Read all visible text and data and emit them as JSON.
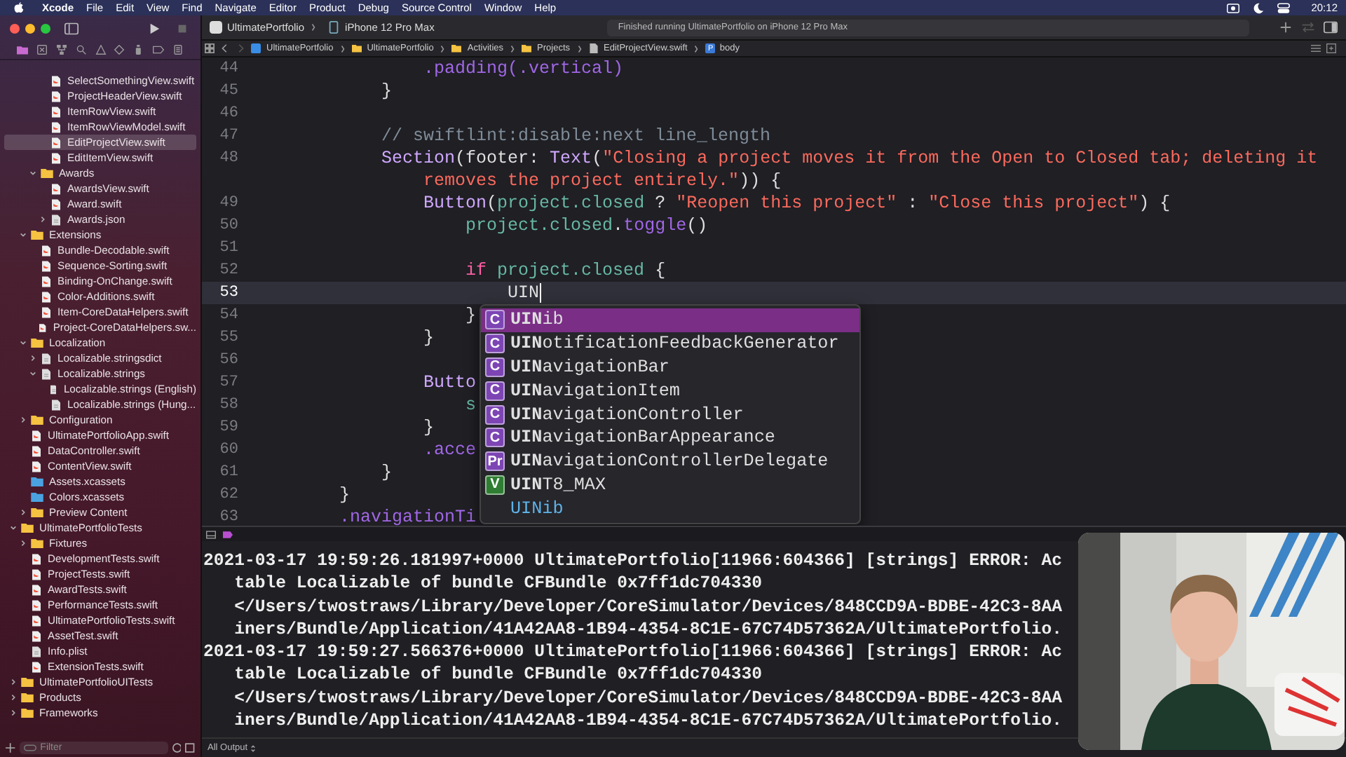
{
  "menu_bar": {
    "items": [
      {
        "label": "Xcode",
        "kind": "app"
      },
      {
        "label": "File",
        "kind": "menu"
      },
      {
        "label": "Edit",
        "kind": "menu"
      },
      {
        "label": "View",
        "kind": "menu"
      },
      {
        "label": "Find",
        "kind": "menu"
      },
      {
        "label": "Navigate",
        "kind": "menu"
      },
      {
        "label": "Editor",
        "kind": "menu"
      },
      {
        "label": "Product",
        "kind": "menu"
      },
      {
        "label": "Debug",
        "kind": "menu"
      },
      {
        "label": "Source Control",
        "kind": "menu"
      },
      {
        "label": "Window",
        "kind": "menu"
      },
      {
        "label": "Help",
        "kind": "menu"
      }
    ],
    "clock": "20:12"
  },
  "toolbar": {
    "scheme": "UltimatePortfolio",
    "device": "iPhone 12 Pro Max",
    "status": "Finished running UltimatePortfolio on iPhone 12 Pro Max"
  },
  "jump_bar": [
    {
      "label": "UltimatePortfolio",
      "kind": "project"
    },
    {
      "label": "UltimatePortfolio",
      "kind": "folder"
    },
    {
      "label": "Activities",
      "kind": "folder"
    },
    {
      "label": "Projects",
      "kind": "folder"
    },
    {
      "label": "EditProjectView.swift",
      "kind": "file"
    },
    {
      "label": "body",
      "kind": "symbol",
      "badge": "P"
    }
  ],
  "sidebar": {
    "filter_placeholder": "Filter",
    "items": [
      {
        "children": [
          {
            "children": [
              {
                "children": [
                  {
                    "name": "SelectSomethingView.swift",
                    "kind": "swift",
                    "selected": false
                  },
                  {
                    "name": "ProjectHeaderView.swift",
                    "kind": "swift",
                    "selected": false
                  },
                  {
                    "name": "ItemRowView.swift",
                    "kind": "swift",
                    "selected": false
                  },
                  {
                    "name": "ItemRowViewModel.swift",
                    "kind": "swift",
                    "selected": false
                  },
                  {
                    "name": "EditProjectView.swift",
                    "kind": "swift",
                    "selected": true
                  },
                  {
                    "name": "EditItemView.swift",
                    "kind": "swift",
                    "selected": false
                  }
                ]
              },
              {
                "name": "Awards",
                "kind": "folder",
                "selected": false,
                "expanded": true,
                "children": [
                  {
                    "name": "AwardsView.swift",
                    "kind": "swift",
                    "selected": false
                  },
                  {
                    "name": "Award.swift",
                    "kind": "swift",
                    "selected": false
                  },
                  {
                    "name": "Awards.json",
                    "kind": "file",
                    "selected": false,
                    "expanded": false
                  }
                ]
              }
            ]
          },
          {
            "name": "Extensions",
            "kind": "folder",
            "selected": false,
            "expanded": true,
            "children": [
              {
                "name": "Bundle-Decodable.swift",
                "kind": "swift",
                "selected": false
              },
              {
                "name": "Sequence-Sorting.swift",
                "kind": "swift",
                "selected": false
              },
              {
                "name": "Binding-OnChange.swift",
                "kind": "swift",
                "selected": false
              },
              {
                "name": "Color-Additions.swift",
                "kind": "swift",
                "selected": false
              },
              {
                "name": "Item-CoreDataHelpers.swift",
                "kind": "swift",
                "selected": false
              },
              {
                "name": "Project-CoreDataHelpers.sw...",
                "kind": "swift",
                "selected": false
              }
            ]
          },
          {
            "name": "Localization",
            "kind": "folder",
            "selected": false,
            "expanded": true,
            "children": [
              {
                "name": "Localizable.stringsdict",
                "kind": "file",
                "selected": false,
                "expanded": false
              },
              {
                "name": "Localizable.strings",
                "kind": "file",
                "selected": false,
                "expanded": true,
                "children": [
                  {
                    "name": "Localizable.strings (English)",
                    "kind": "file",
                    "selected": false
                  },
                  {
                    "name": "Localizable.strings (Hung...",
                    "kind": "file",
                    "selected": false
                  }
                ]
              }
            ]
          },
          {
            "name": "Configuration",
            "kind": "folder",
            "selected": false,
            "expanded": false
          },
          {
            "name": "UltimatePortfolioApp.swift",
            "kind": "swift",
            "selected": false
          },
          {
            "name": "DataController.swift",
            "kind": "swift",
            "selected": false
          },
          {
            "name": "ContentView.swift",
            "kind": "swift",
            "selected": false
          },
          {
            "name": "Assets.xcassets",
            "kind": "assets",
            "selected": false
          },
          {
            "name": "Colors.xcassets",
            "kind": "assets",
            "selected": false
          },
          {
            "name": "Preview Content",
            "kind": "folder",
            "selected": false,
            "expanded": false
          }
        ]
      },
      {
        "name": "UltimatePortfolioTests",
        "kind": "folder",
        "selected": false,
        "expanded": true,
        "children": [
          {
            "name": "Fixtures",
            "kind": "folder",
            "selected": false,
            "expanded": false
          },
          {
            "name": "DevelopmentTests.swift",
            "kind": "swift",
            "selected": false
          },
          {
            "name": "ProjectTests.swift",
            "kind": "swift",
            "selected": false
          },
          {
            "name": "AwardTests.swift",
            "kind": "swift",
            "selected": false
          },
          {
            "name": "PerformanceTests.swift",
            "kind": "swift",
            "selected": false
          },
          {
            "name": "UltimatePortfolioTests.swift",
            "kind": "swift",
            "selected": false
          },
          {
            "name": "AssetTest.swift",
            "kind": "swift",
            "selected": false
          },
          {
            "name": "Info.plist",
            "kind": "file",
            "selected": false
          },
          {
            "name": "ExtensionTests.swift",
            "kind": "swift",
            "selected": false
          }
        ]
      },
      {
        "name": "UltimatePortfolioUITests",
        "kind": "folder",
        "selected": false,
        "expanded": false
      },
      {
        "name": "Products",
        "kind": "folder",
        "selected": false,
        "expanded": false
      },
      {
        "name": "Frameworks",
        "kind": "folder",
        "selected": false,
        "expanded": false
      }
    ]
  },
  "editor": {
    "lines": [
      {
        "number": "44",
        "current": false,
        "code": [
          {
            "t": "                .padding(.vertical)",
            "kind": "method"
          }
        ]
      },
      {
        "number": "45",
        "current": false,
        "code": [
          {
            "t": "            }",
            "kind": "plain"
          }
        ]
      },
      {
        "number": "46",
        "current": false
      },
      {
        "number": "47",
        "current": false,
        "code": [
          {
            "t": "            // swiftlint:disable:next line_length",
            "kind": "comment"
          }
        ]
      },
      {
        "number": "48",
        "current": false,
        "code": [
          {
            "t": "            Section",
            "kind": "type"
          },
          {
            "t": "(footer: ",
            "kind": "plain"
          },
          {
            "t": "Text",
            "kind": "type"
          },
          {
            "t": "(",
            "kind": "plain"
          },
          {
            "t": "\"Closing a project moves it from the Open to Closed tab; deleting it",
            "kind": "string"
          }
        ]
      },
      {
        "current": false,
        "code": [
          {
            "t": "                removes the project entirely.\"",
            "kind": "string"
          },
          {
            "t": ")) {",
            "kind": "plain"
          }
        ]
      },
      {
        "number": "49",
        "current": false,
        "code": [
          {
            "t": "                Button",
            "kind": "type"
          },
          {
            "t": "(",
            "kind": "plain"
          },
          {
            "t": "project.closed",
            "kind": "property"
          },
          {
            "t": " ? ",
            "kind": "plain"
          },
          {
            "t": "\"Reopen this project\"",
            "kind": "string"
          },
          {
            "t": " : ",
            "kind": "plain"
          },
          {
            "t": "\"Close this project\"",
            "kind": "string"
          },
          {
            "t": ") {",
            "kind": "plain"
          }
        ]
      },
      {
        "number": "50",
        "current": false,
        "code": [
          {
            "t": "                    project.closed",
            "kind": "property"
          },
          {
            "t": ".",
            "kind": "plain"
          },
          {
            "t": "toggle",
            "kind": "method"
          },
          {
            "t": "()",
            "kind": "plain"
          }
        ]
      },
      {
        "number": "51",
        "current": false
      },
      {
        "number": "52",
        "current": false,
        "code": [
          {
            "t": "                    if",
            "kind": "keyword"
          },
          {
            "t": " project.closed",
            "kind": "property"
          },
          {
            "t": " {",
            "kind": "plain"
          }
        ]
      },
      {
        "number": "53",
        "current": true,
        "code": [
          {
            "t": "                        UIN",
            "kind": "plain"
          }
        ]
      },
      {
        "number": "54",
        "current": false,
        "code": [
          {
            "t": "                    }",
            "kind": "plain"
          }
        ]
      },
      {
        "number": "55",
        "current": false,
        "code": [
          {
            "t": "                }",
            "kind": "plain"
          }
        ]
      },
      {
        "number": "56",
        "current": false
      },
      {
        "number": "57",
        "current": false,
        "code": [
          {
            "t": "                Butto",
            "kind": "type"
          }
        ]
      },
      {
        "number": "58",
        "current": false,
        "code": [
          {
            "t": "                    s",
            "kind": "property"
          }
        ]
      },
      {
        "number": "59",
        "current": false,
        "code": [
          {
            "t": "                }",
            "kind": "plain"
          }
        ]
      },
      {
        "number": "60",
        "current": false,
        "code": [
          {
            "t": "                .acce",
            "kind": "method"
          }
        ]
      },
      {
        "number": "61",
        "current": false,
        "code": [
          {
            "t": "            }",
            "kind": "plain"
          }
        ]
      },
      {
        "number": "62",
        "current": false,
        "code": [
          {
            "t": "        }",
            "kind": "plain"
          }
        ]
      },
      {
        "number": "63",
        "current": false,
        "code": [
          {
            "t": "        .navigationTi",
            "kind": "method"
          }
        ]
      }
    ]
  },
  "completions": [
    {
      "kind": "class",
      "badge": "C",
      "label": "**UIN**ib",
      "selected": true
    },
    {
      "kind": "class",
      "badge": "C",
      "label": "**UIN**otificationFeedbackGenerator",
      "selected": false
    },
    {
      "kind": "class",
      "badge": "C",
      "label": "**UIN**avigationBar",
      "selected": false
    },
    {
      "kind": "class",
      "badge": "C",
      "label": "**UIN**avigationItem",
      "selected": false
    },
    {
      "kind": "class",
      "badge": "C",
      "label": "**UIN**avigationController",
      "selected": false
    },
    {
      "kind": "class",
      "badge": "C",
      "label": "**UIN**avigationBarAppearance",
      "selected": false
    },
    {
      "kind": "protocol",
      "badge": "Pr",
      "label": "**UIN**avigationControllerDelegate",
      "selected": false
    },
    {
      "kind": "variable",
      "badge": "V",
      "label": "**UIN**T8_MAX",
      "selected": false
    },
    {
      "kind": "detail",
      "label": "UINib",
      "selected": false
    }
  ],
  "console": {
    "lines": [
      "2021-03-17 19:59:26.181997+0000 UltimatePortfolio[11966:604366] [strings] ERROR: Ac",
      "   table Localizable of bundle CFBundle 0x7ff1dc704330",
      "   </Users/twostraws/Library/Developer/CoreSimulator/Devices/848CCD9A-BDBE-42C3-8AA",
      "   iners/Bundle/Application/41A42AA8-1B94-4354-8C1E-67C74D57362A/UltimatePortfolio.",
      "2021-03-17 19:59:27.566376+0000 UltimatePortfolio[11966:604366] [strings] ERROR: Ac",
      "   table Localizable of bundle CFBundle 0x7ff1dc704330",
      "   </Users/twostraws/Library/Developer/CoreSimulator/Devices/848CCD9A-BDBE-42C3-8AA",
      "   iners/Bundle/Application/41A42AA8-1B94-4354-8C1E-67C74D57362A/UltimatePortfolio."
    ],
    "output_filter": "All Output"
  }
}
